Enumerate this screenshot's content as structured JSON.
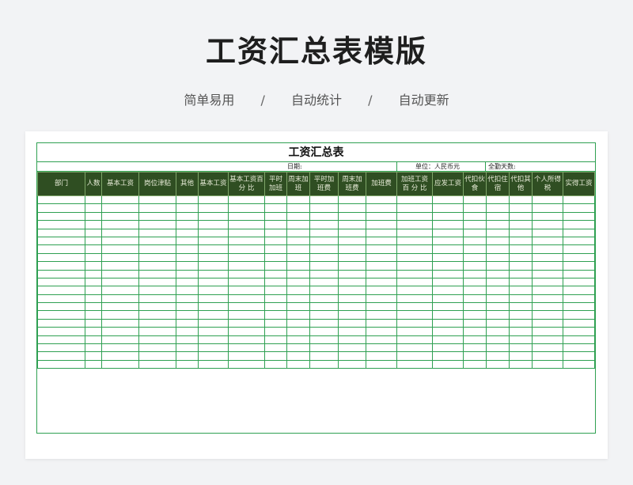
{
  "header": {
    "title": "工资汇总表模版",
    "tags": [
      "简单易用",
      "自动统计",
      "自动更新"
    ],
    "separator": "/"
  },
  "sheet": {
    "title": "工资汇总表",
    "date_label": "日期:",
    "unit_label": "单位：人民币元",
    "attendance_label": "全勤天数:",
    "columns": [
      "部门",
      "人数",
      "基本工资",
      "岗位津贴",
      "其他",
      "基本工资",
      "基本工资百 分 比",
      "平时加班",
      "周末加班",
      "平时加班费",
      "周末加班费",
      "加班费",
      "加班工资百 分 比",
      "应发工资",
      "代扣伙食",
      "代扣住宿",
      "代扣其他",
      "个人所得税",
      "实得工资"
    ],
    "empty_rows": 21
  },
  "colors": {
    "header_fill": "#2f4e22",
    "grid_line": "#2fa052"
  }
}
